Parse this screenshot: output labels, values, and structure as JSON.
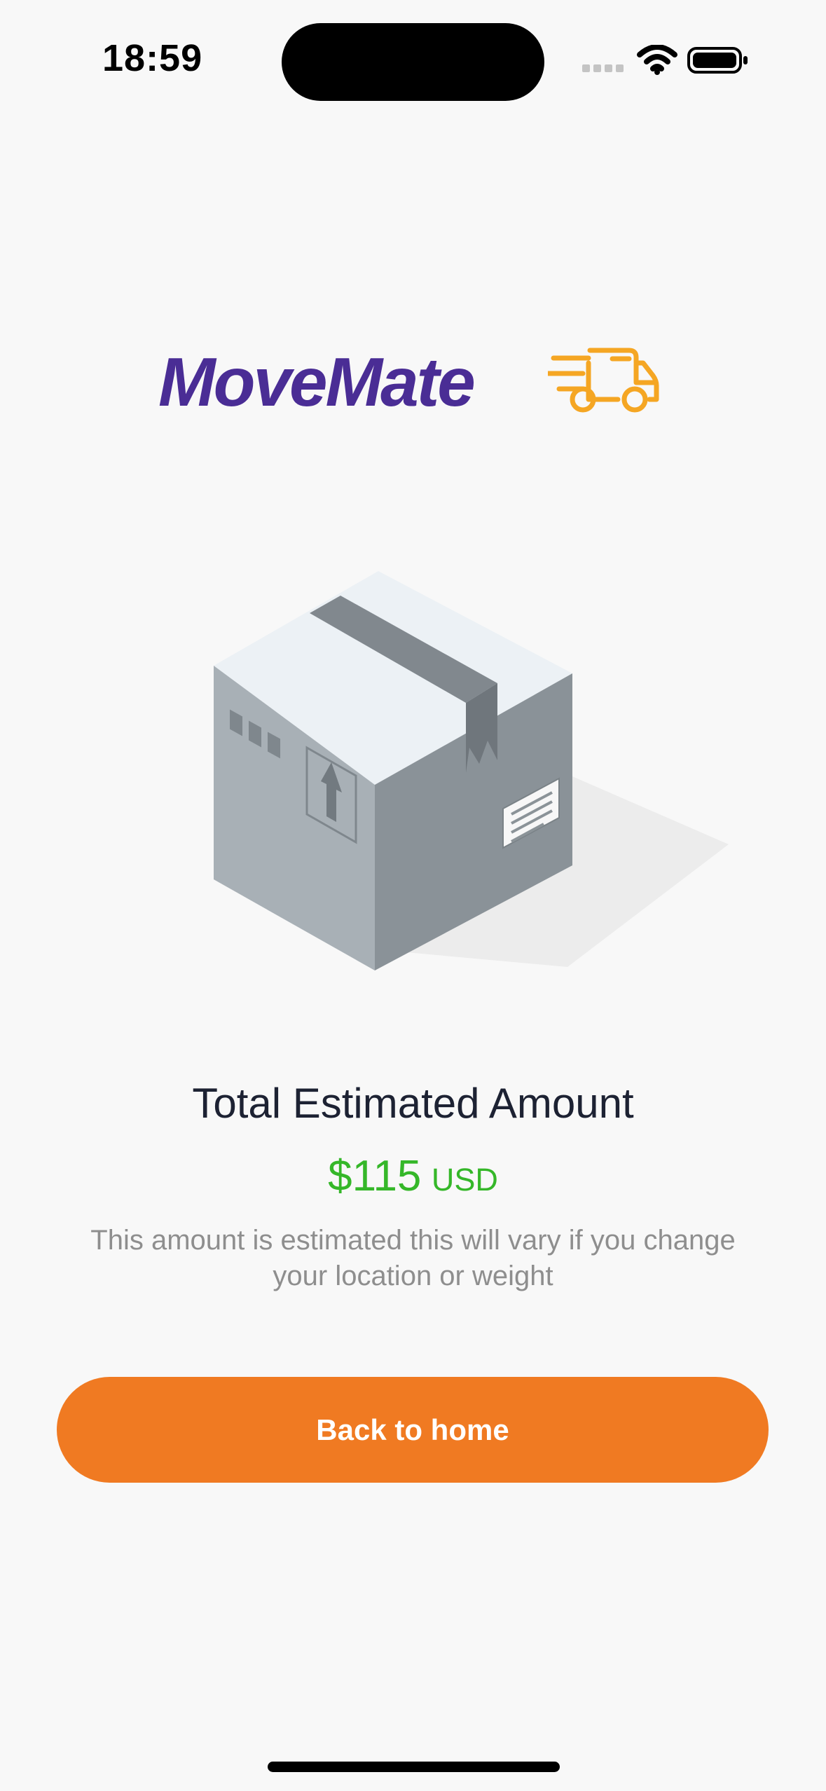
{
  "status_bar": {
    "time": "18:59",
    "icons": [
      "signal-icon",
      "wifi-icon",
      "battery-icon"
    ]
  },
  "app": {
    "name": "MoveMate",
    "brand_color": "#4a2d95",
    "accent_color": "#f5a623",
    "illustration": "package-box-icon"
  },
  "summary": {
    "title": "Total Estimated Amount",
    "amount": "$115",
    "currency": "USD",
    "amount_color": "#35b729",
    "disclaimer": "This amount is estimated this will vary if you change your location or weight"
  },
  "actions": {
    "back_home_label": "Back to home",
    "button_color": "#f07a22"
  }
}
